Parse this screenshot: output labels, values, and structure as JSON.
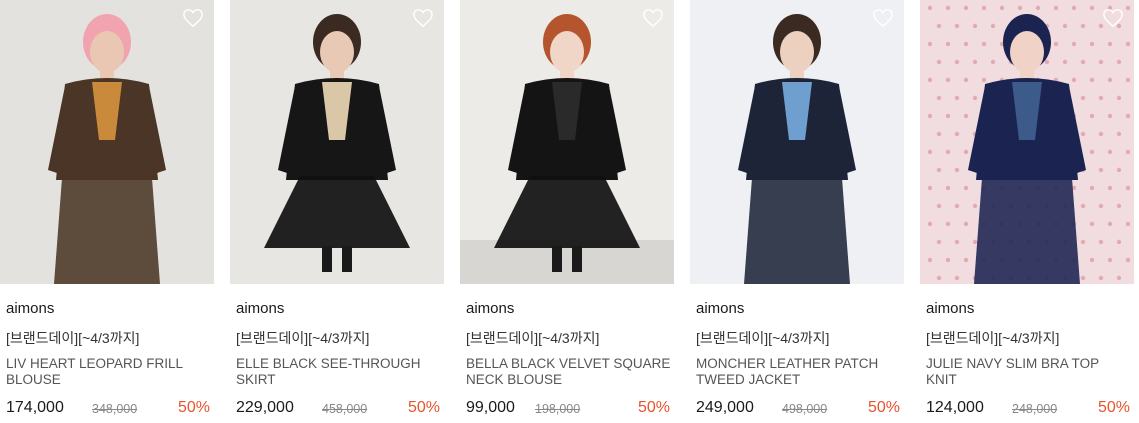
{
  "products": [
    {
      "brand": "aimons",
      "promo": "[브랜드데이][~4/3까지]",
      "name": "LIV HEART LEOPARD FRILL BLOUSE",
      "price": "174,000",
      "original_price": "348,000",
      "discount": "50%",
      "image_alt": "Model in pink beanie, brown coat and leopard bow blouse",
      "colors": {
        "bg": "#e4e2df",
        "primary": "#4a3526",
        "accent": "#c98a3c",
        "hat": "#f2a3b0",
        "skin": "#e9c7b2"
      }
    },
    {
      "brand": "aimons",
      "promo": "[브랜드데이][~4/3까지]",
      "name": "ELLE BLACK SEE-THROUGH SKIRT",
      "price": "229,000",
      "original_price": "458,000",
      "discount": "50%",
      "image_alt": "Model twirling in black tulle skirt and heart sweater",
      "colors": {
        "bg": "#e8e6e3",
        "primary": "#161616",
        "accent": "#d9c7a8",
        "hat": "#3a2a22",
        "skin": "#e8c9b5"
      }
    },
    {
      "brand": "aimons",
      "promo": "[브랜드데이][~4/3까지]",
      "name": "BELLA BLACK VELVET SQUARE NECK BLOUSE",
      "price": "99,000",
      "original_price": "198,000",
      "discount": "50%",
      "image_alt": "Red-haired model in black velvet blouse and tulle skirt",
      "colors": {
        "bg": "#ecebe8",
        "primary": "#141414",
        "accent": "#2a2a2a",
        "hat": "#b5552d",
        "skin": "#f0d6c6"
      }
    },
    {
      "brand": "aimons",
      "promo": "[브랜드데이][~4/3까지]",
      "name": "MONCHER LEATHER PATCH TWEED JACKET",
      "price": "249,000",
      "original_price": "498,000",
      "discount": "50%",
      "image_alt": "Model in navy tweed jacket with blue frill blouse",
      "colors": {
        "bg": "#eef0f3",
        "primary": "#1d2438",
        "accent": "#6f9fcf",
        "hat": "#3a2a22",
        "skin": "#ecd0c0"
      }
    },
    {
      "brand": "aimons",
      "promo": "[브랜드데이][~4/3까지]",
      "name": "JULIE NAVY SLIM BRA TOP KNIT",
      "price": "124,000",
      "original_price": "248,000",
      "discount": "50%",
      "image_alt": "Model in navy beanie and navy knit on floral background",
      "colors": {
        "bg": "#f1dde0",
        "primary": "#1b2350",
        "accent": "#3c5a8a",
        "hat": "#1b2350",
        "skin": "#f0d3c6"
      }
    }
  ]
}
